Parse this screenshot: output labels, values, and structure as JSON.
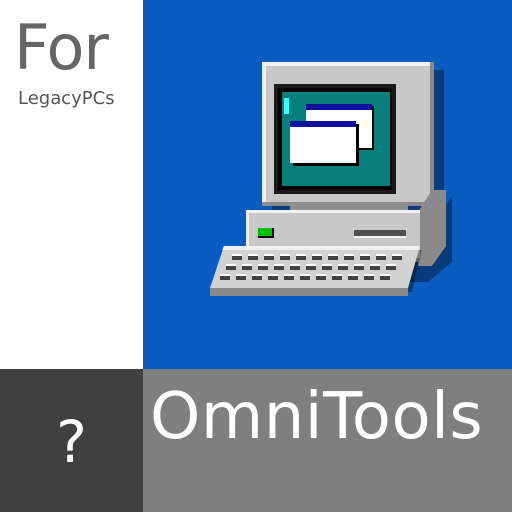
{
  "branding": {
    "for_text": "For",
    "platform_text": "LegacyPCs",
    "help_glyph": "?",
    "app_name": "OmniTools"
  },
  "icons": {
    "main": "retro-desktop-computer-icon",
    "help": "question-mark-icon"
  },
  "colors": {
    "blue_panel": "#0a5cc0",
    "dark_panel": "#404040",
    "gray_panel": "#7f7f7f",
    "white_panel": "#ffffff",
    "screen_teal": "#087f7f",
    "power_led": "#00c000"
  }
}
